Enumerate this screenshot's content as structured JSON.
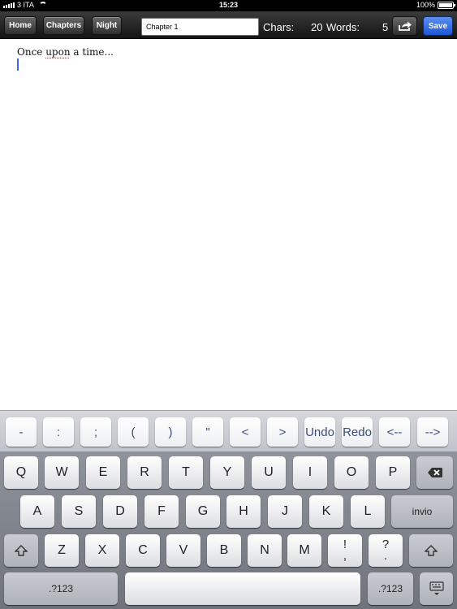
{
  "status_bar": {
    "carrier": "3 ITA",
    "time": "15:23",
    "battery": "100%",
    "battery_level": 1.0
  },
  "toolbar": {
    "home_label": "Home",
    "chapters_label": "Chapters",
    "night_label": "Night",
    "chapter_title_value": "Chapter 1",
    "chars_label": "Chars:",
    "chars_value": "20",
    "words_label": "Words:",
    "words_value": "5",
    "share_icon": "share-icon",
    "save_label": "Save"
  },
  "editor": {
    "text_before": "Once ",
    "text_misspelled": "upon",
    "text_after": " a time..."
  },
  "accessory_keys": [
    "-",
    ":",
    ";",
    "(",
    ")",
    "\"",
    "<",
    ">",
    "Undo",
    "Redo",
    "<--",
    "-->"
  ],
  "keyboard": {
    "row1": [
      "Q",
      "W",
      "E",
      "R",
      "T",
      "Y",
      "U",
      "I",
      "O",
      "P"
    ],
    "row2": [
      "A",
      "S",
      "D",
      "F",
      "G",
      "H",
      "J",
      "K",
      "L"
    ],
    "return_label": "invio",
    "row3": [
      "Z",
      "X",
      "C",
      "V",
      "B",
      "N",
      "M"
    ],
    "punct1_top": "!",
    "punct1_bottom": ",",
    "punct2_top": "?",
    "punct2_bottom": ".",
    "numbers_label": ".?123",
    "icons": {
      "backspace": "backspace-icon",
      "shift": "shift-icon",
      "dismiss": "keyboard-dismiss-icon"
    }
  }
}
